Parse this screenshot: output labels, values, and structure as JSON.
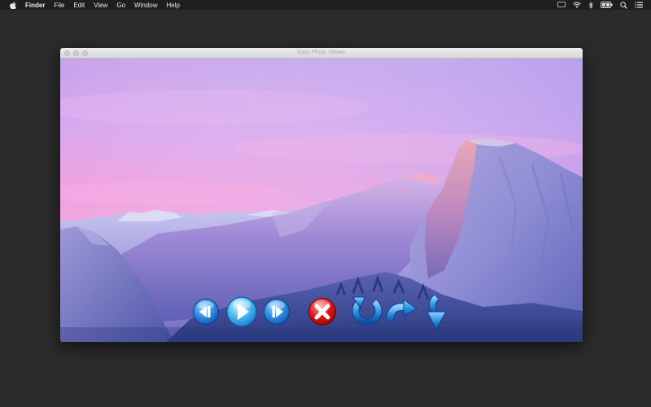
{
  "menubar": {
    "items": [
      "Finder",
      "File",
      "Edit",
      "View",
      "Go",
      "Window",
      "Help"
    ],
    "tray_icons": [
      "airplay-icon",
      "wifi-icon",
      "bluetooth-icon",
      "battery-icon",
      "spotlight-icon",
      "notification-center-icon"
    ]
  },
  "window": {
    "title": "Easy Photo Viewer"
  },
  "photo": {
    "description_icon": "mountain-landscape-image"
  },
  "controls": {
    "buttons": [
      "previous-button",
      "play-button",
      "next-button",
      "delete-button",
      "rotate-left-button",
      "rotate-right-button",
      "download-button"
    ]
  },
  "colors": {
    "menubar_bg": "#1e1e1e",
    "desktop_bg": "#2b2b2b",
    "sky_top": "#c79ee8",
    "sky_pink": "#f2a3e0",
    "button_blue": "#2f8fe0",
    "delete_red": "#d81414"
  }
}
